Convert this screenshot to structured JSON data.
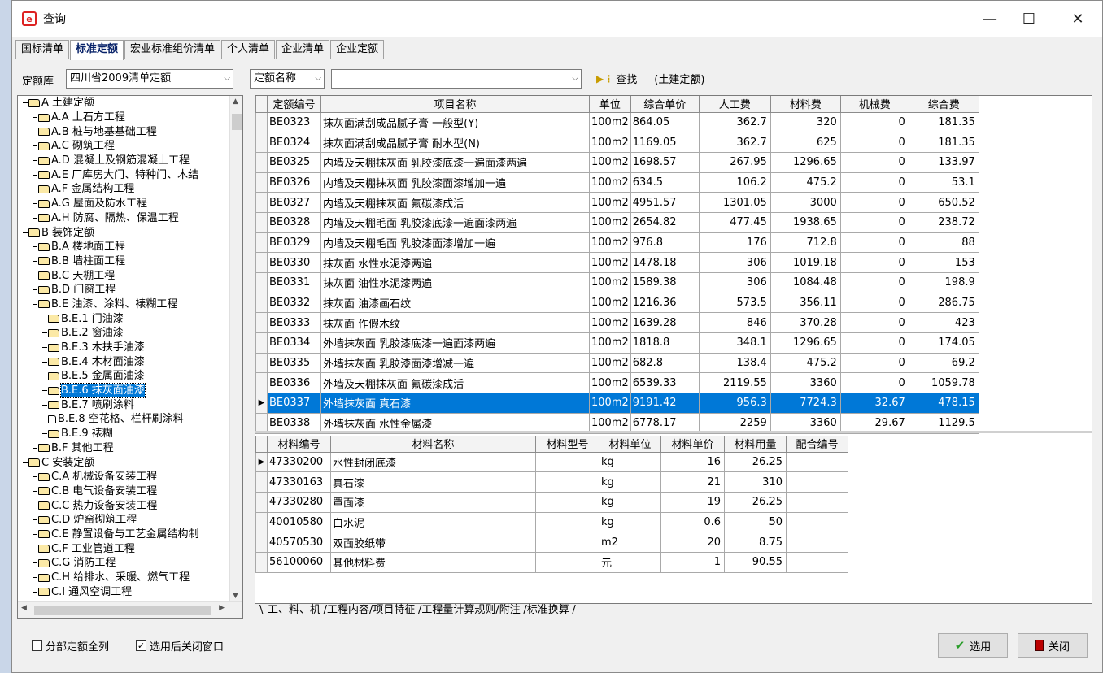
{
  "window": {
    "title": "查询"
  },
  "controls": {
    "minimize": "—",
    "maximize": "☐",
    "close": "✕"
  },
  "tabs": [
    "国标清单",
    "标准定额",
    "宏业标准组价清单",
    "个人清单",
    "企业清单",
    "企业定额"
  ],
  "toolbar": {
    "lib_label": "定额库",
    "lib_value": "四川省2009清单定额",
    "field_value": "定额名称",
    "search_value": "",
    "find_label": "查找",
    "category_note": "(土建定额)"
  },
  "tree": [
    {
      "text": "A 土建定额",
      "level": 0,
      "open": true
    },
    {
      "text": "A.A 土石方工程",
      "level": 1
    },
    {
      "text": "A.B 桩与地基基础工程",
      "level": 1
    },
    {
      "text": "A.C 砌筑工程",
      "level": 1
    },
    {
      "text": "A.D 混凝土及钢筋混凝土工程",
      "level": 1
    },
    {
      "text": "A.E 厂库房大门、特种门、木结",
      "level": 1
    },
    {
      "text": "A.F 金属结构工程",
      "level": 1
    },
    {
      "text": "A.G 屋面及防水工程",
      "level": 1
    },
    {
      "text": "A.H 防腐、隔热、保温工程",
      "level": 1
    },
    {
      "text": "B 装饰定额",
      "level": 0,
      "open": true
    },
    {
      "text": "B.A 楼地面工程",
      "level": 1
    },
    {
      "text": "B.B 墙柱面工程",
      "level": 1
    },
    {
      "text": "B.C 天棚工程",
      "level": 1
    },
    {
      "text": "B.D 门窗工程",
      "level": 1
    },
    {
      "text": "B.E 油漆、涂料、裱糊工程",
      "level": 1,
      "open": true
    },
    {
      "text": "B.E.1 门油漆",
      "level": 2
    },
    {
      "text": "B.E.2 窗油漆",
      "level": 2
    },
    {
      "text": "B.E.3 木扶手油漆",
      "level": 2
    },
    {
      "text": "B.E.4 木材面油漆",
      "level": 2
    },
    {
      "text": "B.E.5 金属面油漆",
      "level": 2
    },
    {
      "text": "B.E.6 抹灰面油漆",
      "level": 2,
      "selected": true
    },
    {
      "text": "B.E.7 喷刷涂料",
      "level": 2
    },
    {
      "text": "B.E.8 空花格、栏杆刷涂料",
      "level": 2,
      "doc": true
    },
    {
      "text": "B.E.9 裱糊",
      "level": 2
    },
    {
      "text": "B.F 其他工程",
      "level": 1
    },
    {
      "text": "C 安装定额",
      "level": 0,
      "open": true
    },
    {
      "text": "C.A 机械设备安装工程",
      "level": 1
    },
    {
      "text": "C.B 电气设备安装工程",
      "level": 1
    },
    {
      "text": "C.C 热力设备安装工程",
      "level": 1
    },
    {
      "text": "C.D 炉窑砌筑工程",
      "level": 1
    },
    {
      "text": "C.E 静置设备与工艺金属结构制",
      "level": 1
    },
    {
      "text": "C.F 工业管道工程",
      "level": 1
    },
    {
      "text": "C.G 消防工程",
      "level": 1
    },
    {
      "text": "C.H 给排水、采暖、燃气工程",
      "level": 1
    },
    {
      "text": "C.I 通风空调工程",
      "level": 1
    }
  ],
  "quota_table": {
    "headers": [
      "定额编号",
      "项目名称",
      "单位",
      "综合单价",
      "人工费",
      "材料费",
      "机械费",
      "综合费"
    ],
    "rows": [
      [
        "BE0323",
        "抹灰面满刮成品腻子膏 一般型(Y)",
        "100m2",
        "864.05",
        "362.7",
        "320",
        "0",
        "181.35"
      ],
      [
        "BE0324",
        "抹灰面满刮成品腻子膏 耐水型(N)",
        "100m2",
        "1169.05",
        "362.7",
        "625",
        "0",
        "181.35"
      ],
      [
        "BE0325",
        "内墙及天棚抹灰面 乳胶漆底漆一遍面漆两遍",
        "100m2",
        "1698.57",
        "267.95",
        "1296.65",
        "0",
        "133.97"
      ],
      [
        "BE0326",
        "内墙及天棚抹灰面 乳胶漆面漆增加一遍",
        "100m2",
        "634.5",
        "106.2",
        "475.2",
        "0",
        "53.1"
      ],
      [
        "BE0327",
        "内墙及天棚抹灰面 氟碳漆成活",
        "100m2",
        "4951.57",
        "1301.05",
        "3000",
        "0",
        "650.52"
      ],
      [
        "BE0328",
        "内墙及天棚毛面 乳胶漆底漆一遍面漆两遍",
        "100m2",
        "2654.82",
        "477.45",
        "1938.65",
        "0",
        "238.72"
      ],
      [
        "BE0329",
        "内墙及天棚毛面 乳胶漆面漆增加一遍",
        "100m2",
        "976.8",
        "176",
        "712.8",
        "0",
        "88"
      ],
      [
        "BE0330",
        "抹灰面 水性水泥漆两遍",
        "100m2",
        "1478.18",
        "306",
        "1019.18",
        "0",
        "153"
      ],
      [
        "BE0331",
        "抹灰面 油性水泥漆两遍",
        "100m2",
        "1589.38",
        "306",
        "1084.48",
        "0",
        "198.9"
      ],
      [
        "BE0332",
        "抹灰面 油漆画石纹",
        "100m2",
        "1216.36",
        "573.5",
        "356.11",
        "0",
        "286.75"
      ],
      [
        "BE0333",
        "抹灰面 作假木纹",
        "100m2",
        "1639.28",
        "846",
        "370.28",
        "0",
        "423"
      ],
      [
        "BE0334",
        "外墙抹灰面 乳胶漆底漆一遍面漆两遍",
        "100m2",
        "1818.8",
        "348.1",
        "1296.65",
        "0",
        "174.05"
      ],
      [
        "BE0335",
        "外墙抹灰面 乳胶漆面漆增减一遍",
        "100m2",
        "682.8",
        "138.4",
        "475.2",
        "0",
        "69.2"
      ],
      [
        "BE0336",
        "外墙及天棚抹灰面 氟碳漆成活",
        "100m2",
        "6539.33",
        "2119.55",
        "3360",
        "0",
        "1059.78"
      ],
      [
        "BE0337",
        "外墙抹灰面 真石漆",
        "100m2",
        "9191.42",
        "956.3",
        "7724.3",
        "32.67",
        "478.15"
      ],
      [
        "BE0338",
        "外墙抹灰面 水性金属漆",
        "100m2",
        "6778.17",
        "2259",
        "3360",
        "29.67",
        "1129.5"
      ]
    ],
    "selected_index": 14
  },
  "material_table": {
    "headers": [
      "材料编号",
      "材料名称",
      "材料型号",
      "材料单位",
      "材料单价",
      "材料用量",
      "配合编号"
    ],
    "rows": [
      [
        "47330200",
        "水性封闭底漆",
        "",
        "kg",
        "16",
        "26.25",
        ""
      ],
      [
        "47330163",
        "真石漆",
        "",
        "kg",
        "21",
        "310",
        ""
      ],
      [
        "47330280",
        "罩面漆",
        "",
        "kg",
        "19",
        "26.25",
        ""
      ],
      [
        "40010580",
        "白水泥",
        "",
        "kg",
        "0.6",
        "50",
        ""
      ],
      [
        "40570530",
        "双面胶纸带",
        "",
        "m2",
        "20",
        "8.75",
        ""
      ],
      [
        "56100060",
        "其他材料费",
        "",
        "元",
        "1",
        "90.55",
        ""
      ]
    ]
  },
  "bottom_tabs": [
    "工、料、机",
    "工程内容/项目特征",
    "工程量计算规则/附注",
    "标准换算"
  ],
  "footer": {
    "check1_label": "分部定额全列",
    "check1_checked": false,
    "check2_label": "选用后关闭窗口",
    "check2_checked": true,
    "select_btn": "选用",
    "close_btn": "关闭"
  }
}
